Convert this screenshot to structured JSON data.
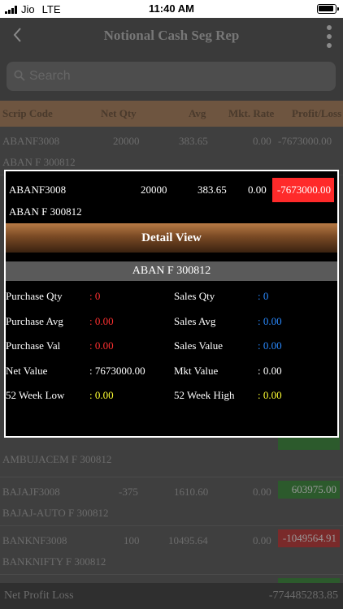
{
  "status": {
    "carrier": "Jio",
    "network": "LTE",
    "time": "11:40 AM"
  },
  "header": {
    "title": "Notional Cash Seg Rep"
  },
  "search": {
    "placeholder": "Search"
  },
  "columns": {
    "scrip_code": "Scrip Code",
    "net_qty": "Net Qty",
    "avg": "Avg",
    "mkt_rate": "Mkt. Rate",
    "profit_loss": "Profit/Loss"
  },
  "rows": [
    {
      "code": "ABANF3008",
      "qty": "20000",
      "avg": "383.65",
      "mkt": "0.00",
      "pl": "-7673000.00",
      "name": "ABAN F 300812",
      "pl_kind": "none"
    },
    {
      "code": "",
      "qty": "",
      "avg": "",
      "mkt": "",
      "pl": "",
      "name": "AMBUJACEM F 300812",
      "pl_kind": "pos"
    },
    {
      "code": "BAJAJF3008",
      "qty": "-375",
      "avg": "1610.60",
      "mkt": "0.00",
      "pl": "603975.00",
      "name": "BAJAJ-AUTO F 300812",
      "pl_kind": "pos"
    },
    {
      "code": "BANKNF3008",
      "qty": "100",
      "avg": "10495.64",
      "mkt": "0.00",
      "pl": "-1049564.91",
      "name": "BANKNIFTY F 300812",
      "pl_kind": "neg"
    }
  ],
  "footer": {
    "label": "Net Profit Loss",
    "value": "-774485283.85"
  },
  "popup": {
    "code": "ABANF3008",
    "qty": "20000",
    "avg": "383.65",
    "mkt": "0.00",
    "pl": "-7673000.00",
    "name": "ABAN F 300812",
    "detail_button": "Detail View",
    "sub_title": "ABAN F 300812",
    "details": {
      "purchase_qty_label": "Purchase Qty",
      "purchase_qty": ": 0",
      "sales_qty_label": "Sales Qty",
      "sales_qty": ": 0",
      "purchase_avg_label": "Purchase Avg",
      "purchase_avg": ": 0.00",
      "sales_avg_label": "Sales Avg",
      "sales_avg": ": 0.00",
      "purchase_val_label": "Purchase Val",
      "purchase_val": ": 0.00",
      "sales_value_label": "Sales Value",
      "sales_value": ": 0.00",
      "net_value_label": "Net Value",
      "net_value": ": 7673000.00",
      "mkt_value_label": "Mkt Value",
      "mkt_value": ": 0.00",
      "week52_low_label": "52 Week Low",
      "week52_low": ": 0.00",
      "week52_high_label": "52 Week High",
      "week52_high": ": 0.00"
    }
  },
  "colors": {
    "pl_negative": "#ff2a2a",
    "pl_positive": "#2c5a2c",
    "header_bar": "#6e5540",
    "detail_button": "#7a4a25"
  }
}
